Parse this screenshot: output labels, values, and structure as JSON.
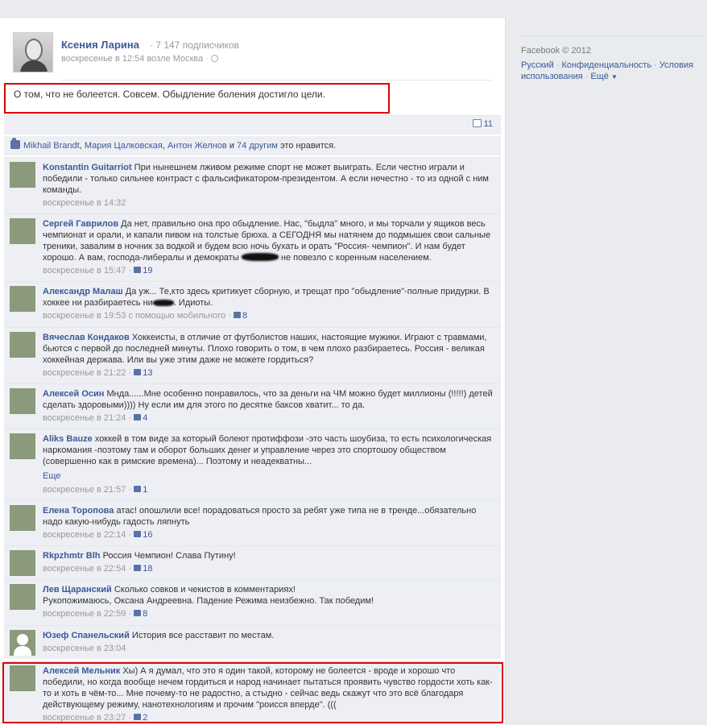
{
  "post": {
    "author": "Ксения Ларина",
    "subscribers": "· 7 147 подписчиков",
    "meta": "воскресенье в 12:54 возле Москва",
    "text": "О том, что не болеется. Совсем. Обыдление боления достигло цели.",
    "comment_count": "11"
  },
  "likes": {
    "names": [
      "Mikhail Brandt",
      "Мария Цалковская",
      "Антон Желнов"
    ],
    "others": "74 другим",
    "and_word": "и",
    "suffix": "это нравится."
  },
  "comments": [
    {
      "name": "Konstantin Guitarriot",
      "text": "При нынешнем лживом режиме спорт не может выиграть. Если честно играли и победили - только сильнее контраст с фальсификатором-президентом. А если нечестно - то из одной с ним команды.",
      "time": "воскресенье в 14:32",
      "likes": ""
    },
    {
      "name": "Сергей Гаврилов",
      "text_a": "Да нет, правильно она про обыдление. Нас, \"быдла\" много, и мы торчали у ящиков весь чемпионат и орали, и капали пивом на толстые брюха. а СЕГОДНЯ мы натянем до подмышек свои сальные треники, завалим в ночник за водкой и будем всю ночь бухать и орать \"Россия- чемпион\". И нам будет хорошо. А вам, господа-либералы и демократы",
      "text_b": "не повезло с коренным населением.",
      "time": "воскресенье в 15:47",
      "likes": "19"
    },
    {
      "name": "Александр Малаш",
      "text_a": "Да уж... Те,кто здесь критикует сборную, и трещат про \"обыдление\"-полные придурки. В хоккее ни разбираетесь ни",
      "text_b": ". Идиоты.",
      "time": "воскресенье в 19:53 с помощью мобильного",
      "likes": "8"
    },
    {
      "name": "Вячеслав Кондаков",
      "text": "Хоккеисты, в отличие от футболистов наших, настоящие мужики. Играют с травмами, бьются с первой до последней минуты. Плохо говорить о том, в чем плохо разбираетесь. Россия - великая хоккейная держава. Или вы уже этим даже не можете гордиться?",
      "time": "воскресенье в 21:22",
      "likes": "13"
    },
    {
      "name": "Алексей Осин",
      "text": "Мнда......Мне особенно понравилось, что за деньги на ЧМ можно будет миллионы (!!!!!) детей сделать здоровыми)))) Ну если им для этого по десятке баксов хватит... то да.",
      "time": "воскресенье в 21:24",
      "likes": "4"
    },
    {
      "name": "Aliks Bauze",
      "text": "хоккей в том виде за который болеют протиффози -это часть шоубиза, то есть психологическая наркомания -поэтому там и оборот больших денег и управление через это спортошоу обществом (совершенно как в римские времена)... Поэтому и неадекватны...",
      "more": "Еще",
      "time": "воскресенье в 21:57",
      "likes": "1"
    },
    {
      "name": "Елена Торопова",
      "text": "атас! опошлили все! порадоваться просто за ребят уже типа не в тренде...обязательно надо какую-нибудь гадость ляпнуть",
      "time": "воскресенье в 22:14",
      "likes": "16"
    },
    {
      "name": "Rkpzhmtr Blh",
      "text": "Россия Чемпион! Слава Путину!",
      "time": "воскресенье в 22:54",
      "likes": "18"
    },
    {
      "name": "Лев Щаранский",
      "text": "Сколько совков и чекистов в комментариях!",
      "text2": "Рукопожимаюсь, Оксана Андреевна. Падение Режима неизбежно. Так победим!",
      "time": "воскресенье в 22:59",
      "likes": "8"
    },
    {
      "name": "Юзеф Спанельский",
      "text": "История все расставит по местам.",
      "time": "воскресенье в 23:04",
      "likes": ""
    },
    {
      "name": "Алексей Мельник",
      "text": "Хы) А я думал, что это я один такой, которому не болеется - вроде и хорошо что победили, но когда вообще нечем гордиться и народ начинает пытаться проявить чувство гордости хоть как-то и хоть в чём-то... Мне почему-то не радостно, а стыдно - сейчас ведь скажут что это всё благодаря действующему режиму, нанотехнологиям и прочим \"роисся вперде\". (((",
      "time": "воскресенье в 23:27",
      "likes": "2"
    }
  ],
  "sidebar": {
    "copyright": "Facebook © 2012",
    "links": [
      "Русский",
      "Конфиденциальность",
      "Условия использования",
      "Ещё"
    ]
  },
  "colors": {
    "link": "#3b5998",
    "highlight_border": "#dd0000",
    "comment_bg": "#edeff4"
  }
}
